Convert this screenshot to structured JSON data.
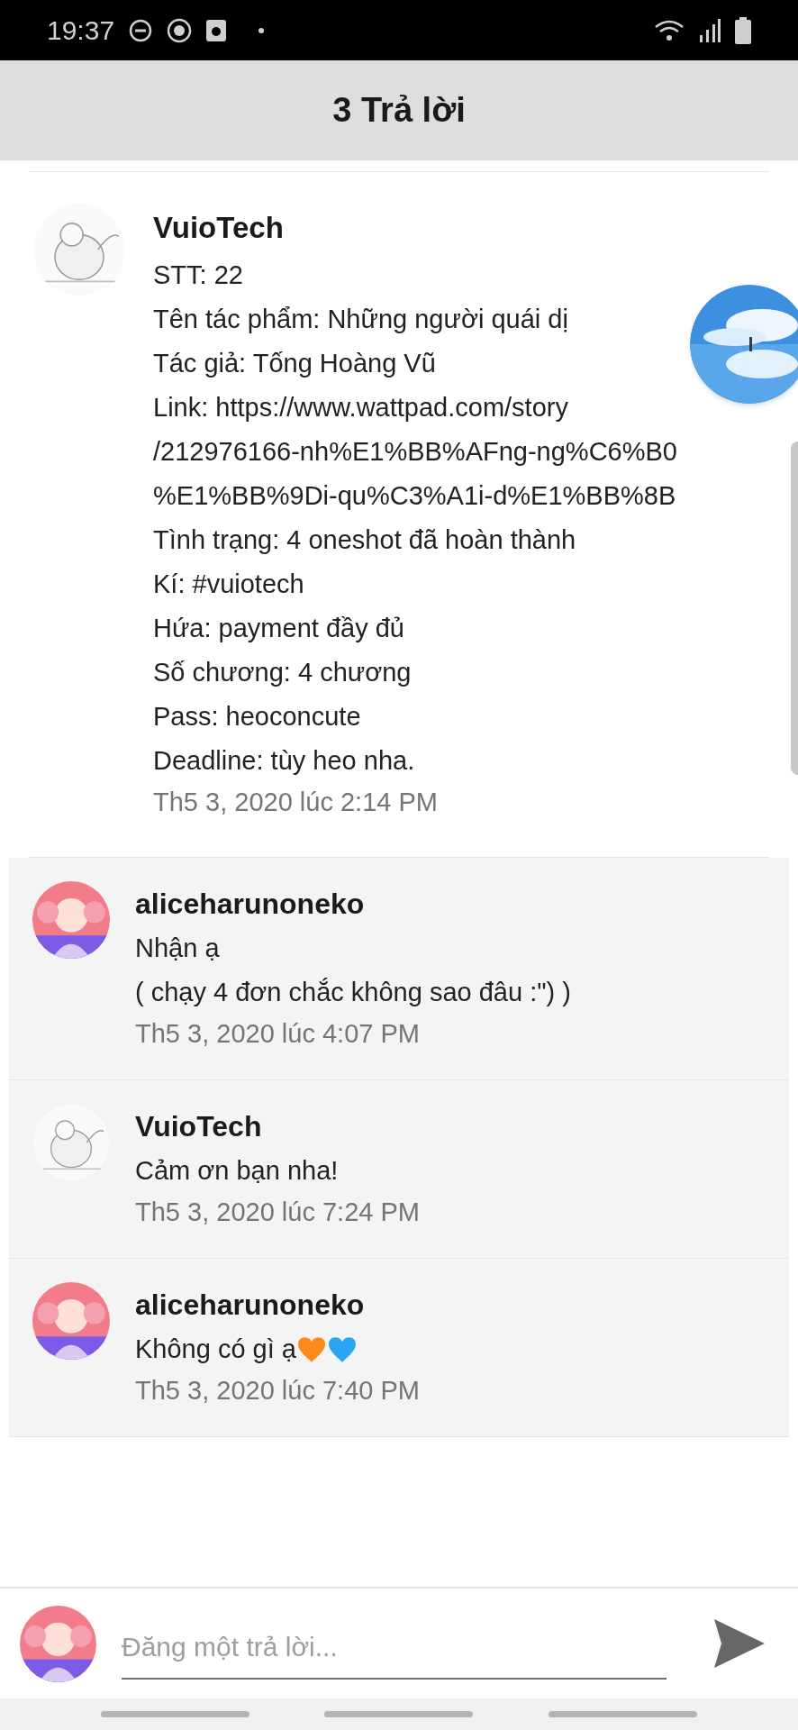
{
  "status_bar": {
    "time": "19:37"
  },
  "header": {
    "title": "3 Trả lời"
  },
  "post": {
    "author": "VuioTech",
    "avatar": {
      "kind": "sketch"
    },
    "lines": [
      "STT: 22",
      "Tên tác phẩm: Những người quái dị",
      "Tác giả: Tống Hoàng Vũ",
      "Link: https://www.wattpad.com/story",
      "/212976166-nh%E1%BB%AFng-ng%C6%B0",
      "%E1%BB%9Di-qu%C3%A1i-d%E1%BB%8B",
      "Tình trạng: 4 oneshot đã hoàn thành",
      "Kí: #vuiotech",
      "Hứa: payment đầy đủ",
      "Số chương: 4 chương",
      "Pass: heoconcute",
      "Deadline: tùy heo nha."
    ],
    "time": "Th5 3, 2020 lúc 2:14 PM"
  },
  "replies": [
    {
      "author": "aliceharunoneko",
      "avatar": {
        "kind": "pink"
      },
      "lines": [
        "Nhận ạ",
        "( chạy 4 đơn chắc không sao đâu :\") )"
      ],
      "time": "Th5 3, 2020 lúc 4:07 PM"
    },
    {
      "author": "VuioTech",
      "avatar": {
        "kind": "sketch"
      },
      "lines": [
        "Cảm ơn bạn nha!"
      ],
      "time": "Th5 3, 2020 lúc 7:24 PM"
    },
    {
      "author": "aliceharunoneko",
      "avatar": {
        "kind": "pink"
      },
      "lines": [
        "Không có gì ạ"
      ],
      "hearts": [
        {
          "color": "#ff8a1c"
        },
        {
          "color": "#2aa5f0"
        }
      ],
      "time": "Th5 3, 2020 lúc 7:40 PM"
    }
  ],
  "composer": {
    "avatar": {
      "kind": "pink"
    },
    "placeholder": "Đăng một trả lời..."
  }
}
